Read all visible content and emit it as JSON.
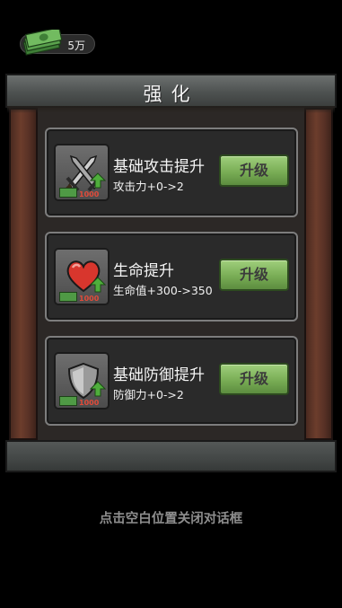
{
  "currency": {
    "icon": "cash-stack-icon",
    "value": "5万"
  },
  "panel": {
    "title": "强化"
  },
  "upgrades": [
    {
      "icon": "sword-icon",
      "title": "基础攻击提升",
      "desc": "攻击力+0->2",
      "button": "升级",
      "cost_text": "1000"
    },
    {
      "icon": "heart-icon",
      "title": "生命提升",
      "desc": "生命值+300->350",
      "button": "升级",
      "cost_text": "1000"
    },
    {
      "icon": "shield-icon",
      "title": "基础防御提升",
      "desc": "防御力+0->2",
      "button": "升级",
      "cost_text": "1000"
    }
  ],
  "hint": "点击空白位置关闭对话框",
  "colors": {
    "button": "#79ad55",
    "cost": "#e04b3a",
    "arrow": "#4fae3c"
  }
}
